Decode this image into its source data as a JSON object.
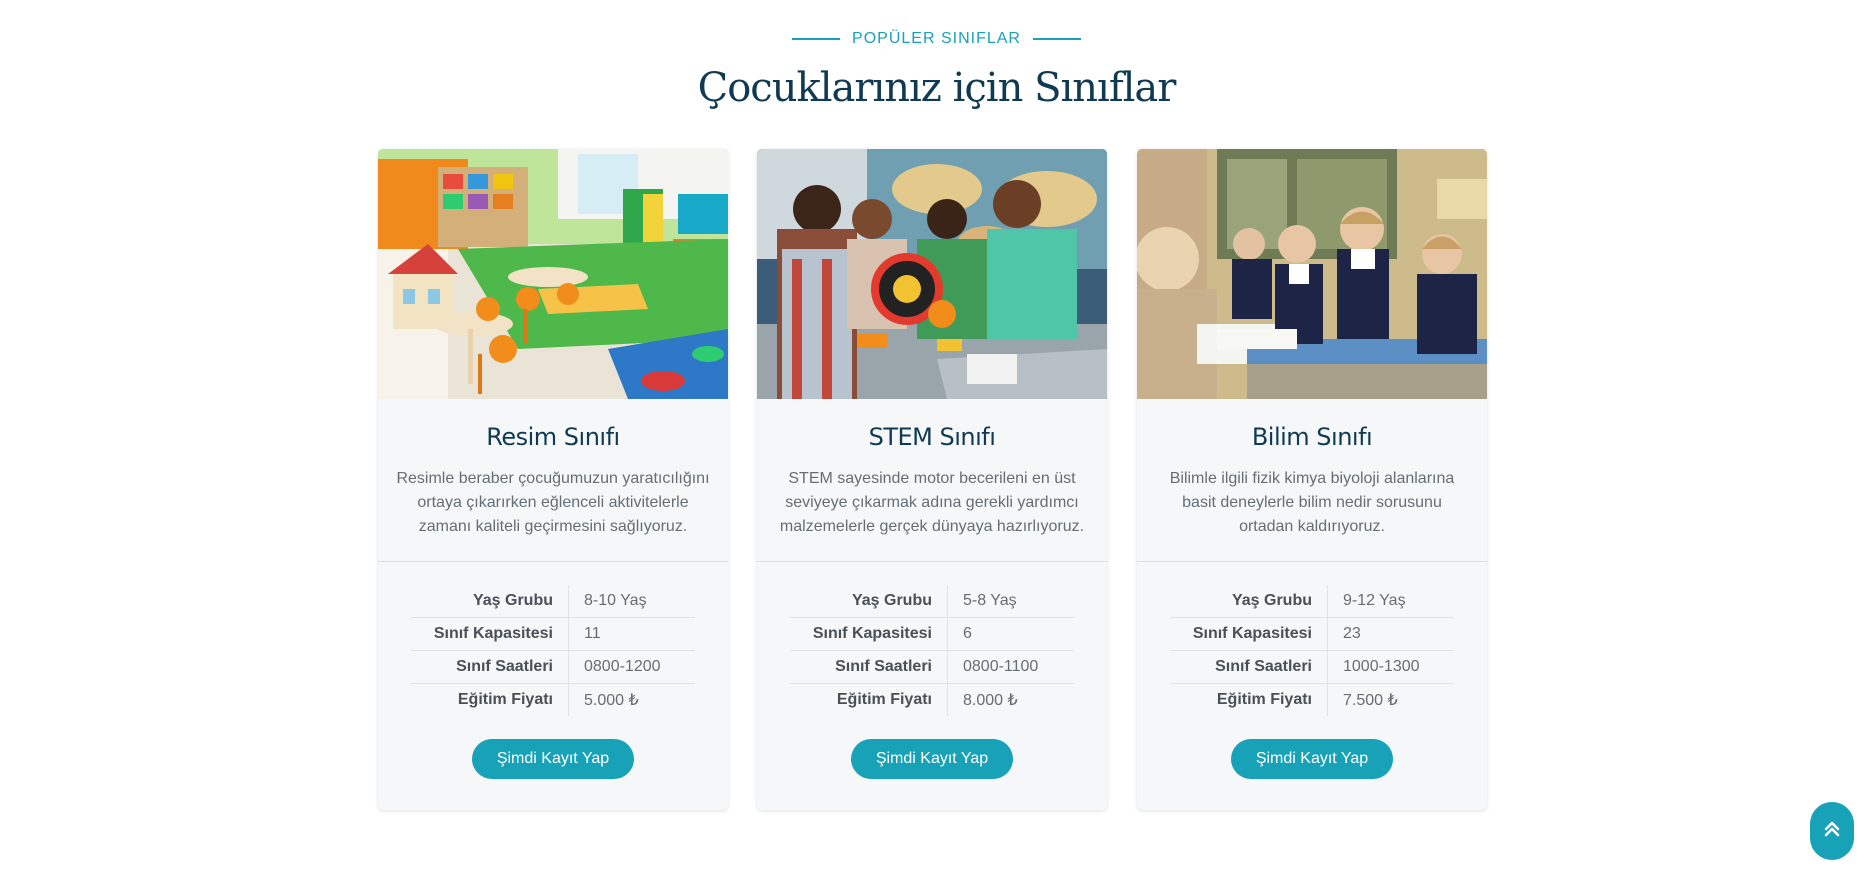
{
  "section": {
    "eyebrow": "POPÜLER SINIFLAR",
    "title": "Çocuklarınız için Sınıflar"
  },
  "classes": [
    {
      "title": "Resim Sınıfı",
      "description": "Resimle beraber çocuğumuzun yaratıcılığını ortaya çıkarırken eğlenceli aktivitelerle zamanı kaliteli geçirmesini sağlıyoruz.",
      "details": [
        {
          "label": "Yaş Grubu",
          "value": "8-10 Yaş"
        },
        {
          "label": "Sınıf Kapasitesi",
          "value": "11"
        },
        {
          "label": "Sınıf Saatleri",
          "value": "0800-1200"
        },
        {
          "label": "Eğitim Fiyatı",
          "value": "5.000 ₺"
        }
      ],
      "button": "Şimdi Kayıt Yap"
    },
    {
      "title": "STEM Sınıfı",
      "description": "STEM sayesinde motor becerileni en üst seviyeye çıkarmak adına gerekli yardımcı malzemelerle gerçek dünyaya hazırlıyoruz.",
      "details": [
        {
          "label": "Yaş Grubu",
          "value": "5-8 Yaş"
        },
        {
          "label": "Sınıf Kapasitesi",
          "value": "6"
        },
        {
          "label": "Sınıf Saatleri",
          "value": "0800-1100"
        },
        {
          "label": "Eğitim Fiyatı",
          "value": "8.000 ₺"
        }
      ],
      "button": "Şimdi Kayıt Yap"
    },
    {
      "title": "Bilim Sınıfı",
      "description": "Bilimle ilgili fizik kimya biyoloji alanlarına basit deneylerle bilim nedir sorusunu ortadan kaldırıyoruz.",
      "details": [
        {
          "label": "Yaş Grubu",
          "value": "9-12 Yaş"
        },
        {
          "label": "Sınıf Kapasitesi",
          "value": "23"
        },
        {
          "label": "Sınıf Saatleri",
          "value": "1000-1300"
        },
        {
          "label": "Eğitim Fiyatı",
          "value": "7.500 ₺"
        }
      ],
      "button": "Şimdi Kayıt Yap"
    }
  ],
  "colors": {
    "accent": "#17a2b8",
    "heading": "#103a52",
    "card_bg": "#f5f7f9"
  },
  "icons": {
    "scroll_top": "double-chevron-up-icon"
  }
}
